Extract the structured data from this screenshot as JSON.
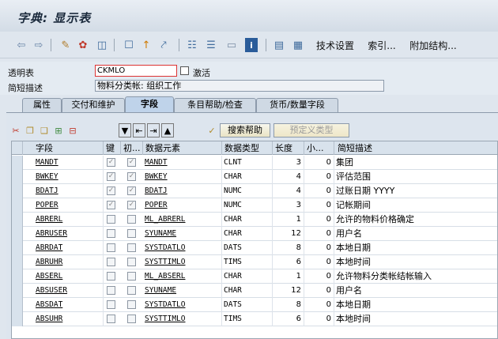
{
  "window": {
    "title": "字典: 显示表"
  },
  "toolbar": {
    "icons": [
      "arrow-left-icon",
      "arrow-right-icon",
      "pencil-glasses-icon",
      "display-change-icon",
      "object-tree-icon",
      "where-used-icon",
      "pointer-icon",
      "hierarchy-icon",
      "stack-icon",
      "screen-icon",
      "info-icon",
      "structure-icon",
      "grid-icon"
    ],
    "tech_settings": "技术设置",
    "index": "索引...",
    "append_structure": "附加结构..."
  },
  "header": {
    "transparent_table_label": "透明表",
    "transparent_table_value": "CKMLO",
    "active_label": "激活",
    "short_desc_label": "简短描述",
    "short_desc_value": "物料分类帐: 组织工作"
  },
  "tabs": [
    {
      "label": "属性"
    },
    {
      "label": "交付和维护"
    },
    {
      "label": "字段"
    },
    {
      "label": "条目帮助/检查"
    },
    {
      "label": "货币/数量字段"
    }
  ],
  "grid_toolbar": {
    "search_help": "搜索帮助",
    "predefined_type": "预定义类型"
  },
  "columns": [
    "字段",
    "键",
    "初...",
    "数据元素",
    "数据类型",
    "长度",
    "小...",
    "简短描述"
  ],
  "rows": [
    {
      "field": "MANDT",
      "key": true,
      "init": true,
      "element": "MANDT",
      "type": "CLNT",
      "len": "3",
      "dec": "0",
      "desc": "集团"
    },
    {
      "field": "BWKEY",
      "key": true,
      "init": true,
      "element": "BWKEY",
      "type": "CHAR",
      "len": "4",
      "dec": "0",
      "desc": "评估范围"
    },
    {
      "field": "BDATJ",
      "key": true,
      "init": true,
      "element": "BDATJ",
      "type": "NUMC",
      "len": "4",
      "dec": "0",
      "desc": "过账日期 YYYY"
    },
    {
      "field": "POPER",
      "key": true,
      "init": true,
      "element": "POPER",
      "type": "NUMC",
      "len": "3",
      "dec": "0",
      "desc": "记帐期间"
    },
    {
      "field": "ABRERL",
      "key": false,
      "init": false,
      "element": "ML_ABRERL",
      "type": "CHAR",
      "len": "1",
      "dec": "0",
      "desc": "允许的物料价格确定"
    },
    {
      "field": "ABRUSER",
      "key": false,
      "init": false,
      "element": "SYUNAME",
      "type": "CHAR",
      "len": "12",
      "dec": "0",
      "desc": "用户名"
    },
    {
      "field": "ABRDAT",
      "key": false,
      "init": false,
      "element": "SYSTDATLO",
      "type": "DATS",
      "len": "8",
      "dec": "0",
      "desc": "本地日期"
    },
    {
      "field": "ABRUHR",
      "key": false,
      "init": false,
      "element": "SYSTTIMLO",
      "type": "TIMS",
      "len": "6",
      "dec": "0",
      "desc": "本地时间"
    },
    {
      "field": "ABSERL",
      "key": false,
      "init": false,
      "element": "ML_ABSERL",
      "type": "CHAR",
      "len": "1",
      "dec": "0",
      "desc": "允许物料分类帐结帐输入"
    },
    {
      "field": "ABSUSER",
      "key": false,
      "init": false,
      "element": "SYUNAME",
      "type": "CHAR",
      "len": "12",
      "dec": "0",
      "desc": "用户名"
    },
    {
      "field": "ABSDAT",
      "key": false,
      "init": false,
      "element": "SYSTDATLO",
      "type": "DATS",
      "len": "8",
      "dec": "0",
      "desc": "本地日期"
    },
    {
      "field": "ABSUHR",
      "key": false,
      "init": false,
      "element": "SYSTTIMLO",
      "type": "TIMS",
      "len": "6",
      "dec": "0",
      "desc": "本地时间"
    }
  ]
}
